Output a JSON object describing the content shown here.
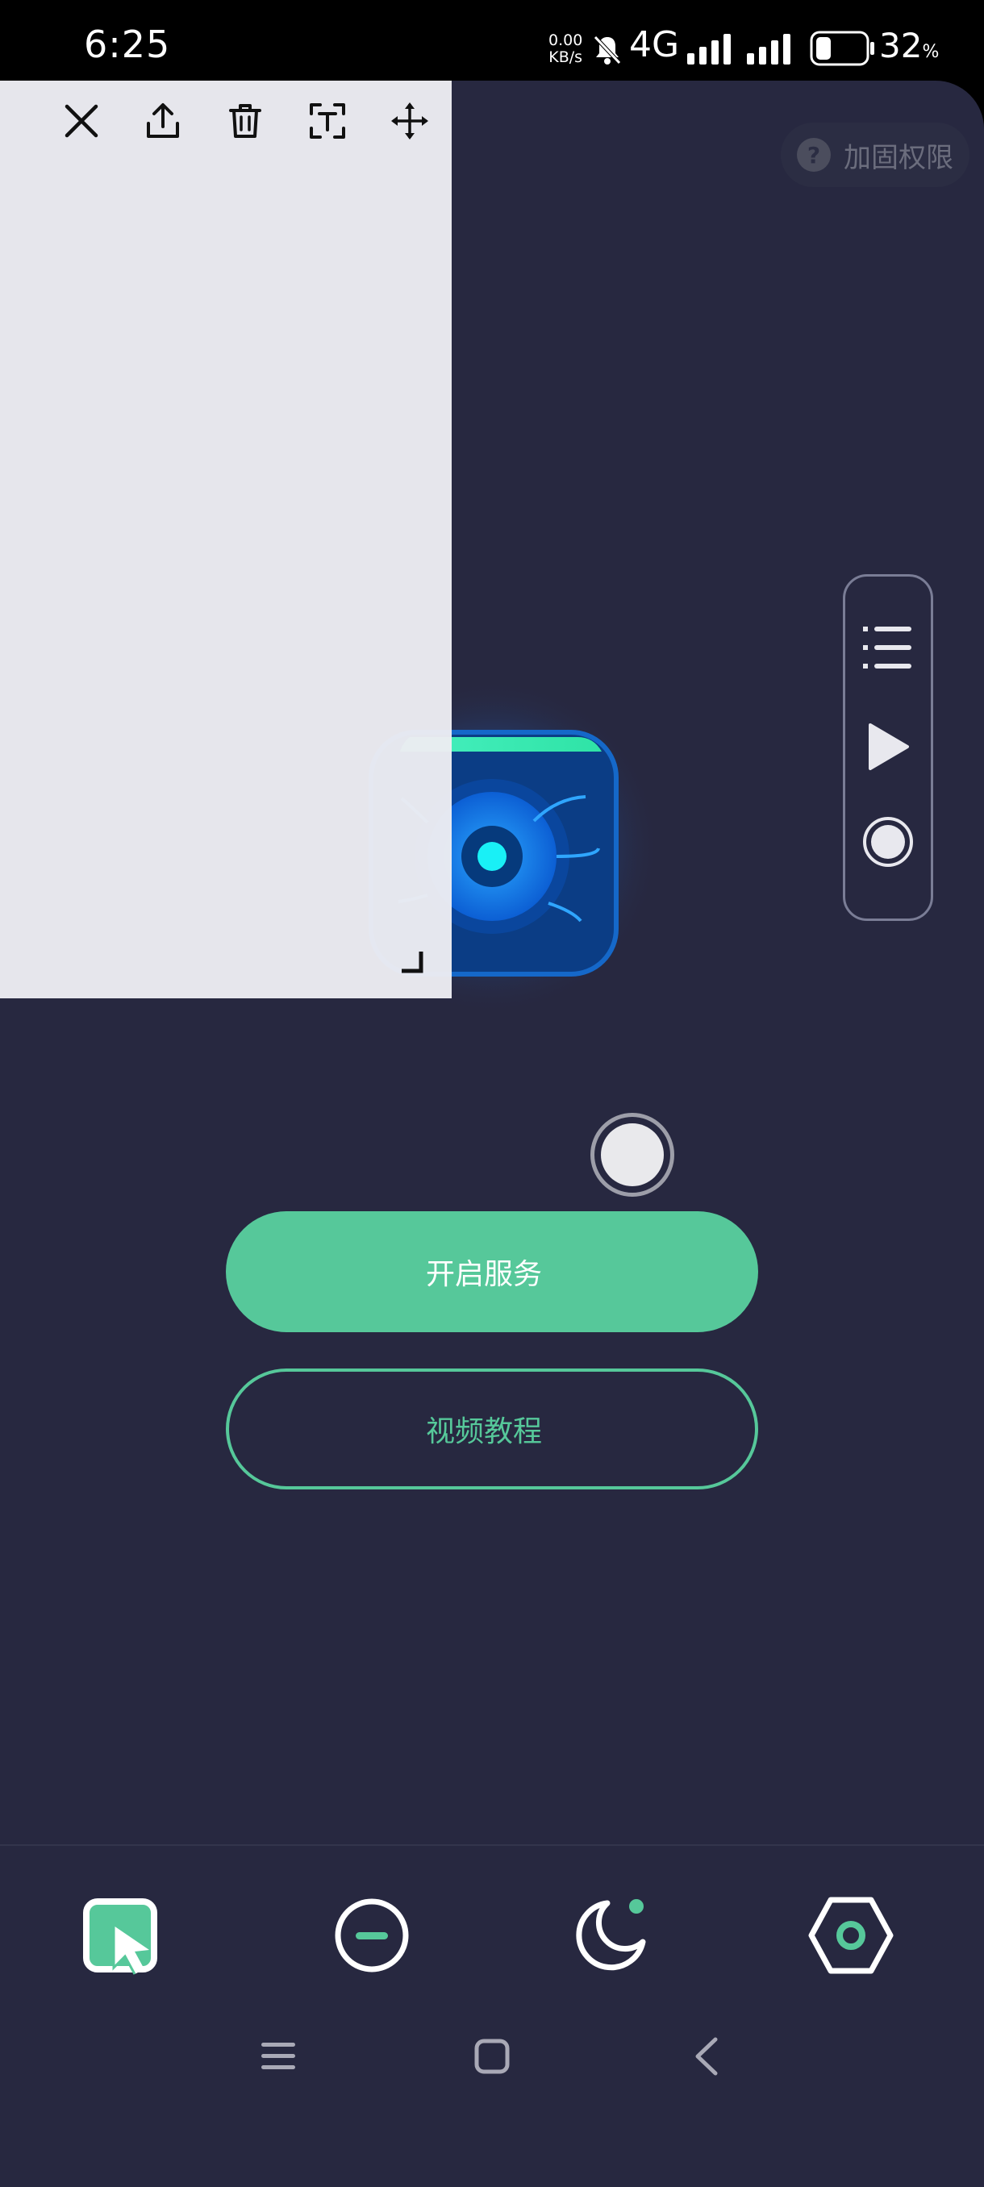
{
  "status_bar": {
    "time": "6:25",
    "net_speed_value": "0.00",
    "net_speed_unit": "KB/s",
    "network": "4G",
    "battery_percent": "32",
    "battery_symbol": "%"
  },
  "app": {
    "harden_label": "加固权限",
    "harden_icon_glyph": "?",
    "start_service_label": "开启服务",
    "video_tutorial_label": "视频教程",
    "accent_color": "#56c89a",
    "background_color": "#272840"
  },
  "floating_panel": {
    "icons": [
      "list-icon",
      "play-icon",
      "record-icon"
    ]
  },
  "bottom_tabs": {
    "icons": [
      "cursor-click-icon",
      "minus-circle-icon",
      "moon-icon",
      "settings-hexagon-icon"
    ]
  },
  "nav_bar": {
    "icons": [
      "menu-icon",
      "home-icon",
      "back-icon"
    ]
  },
  "overlay_toolbar": {
    "icons": [
      "close-icon",
      "share-icon",
      "delete-icon",
      "text-recognition-icon",
      "move-icon"
    ]
  }
}
